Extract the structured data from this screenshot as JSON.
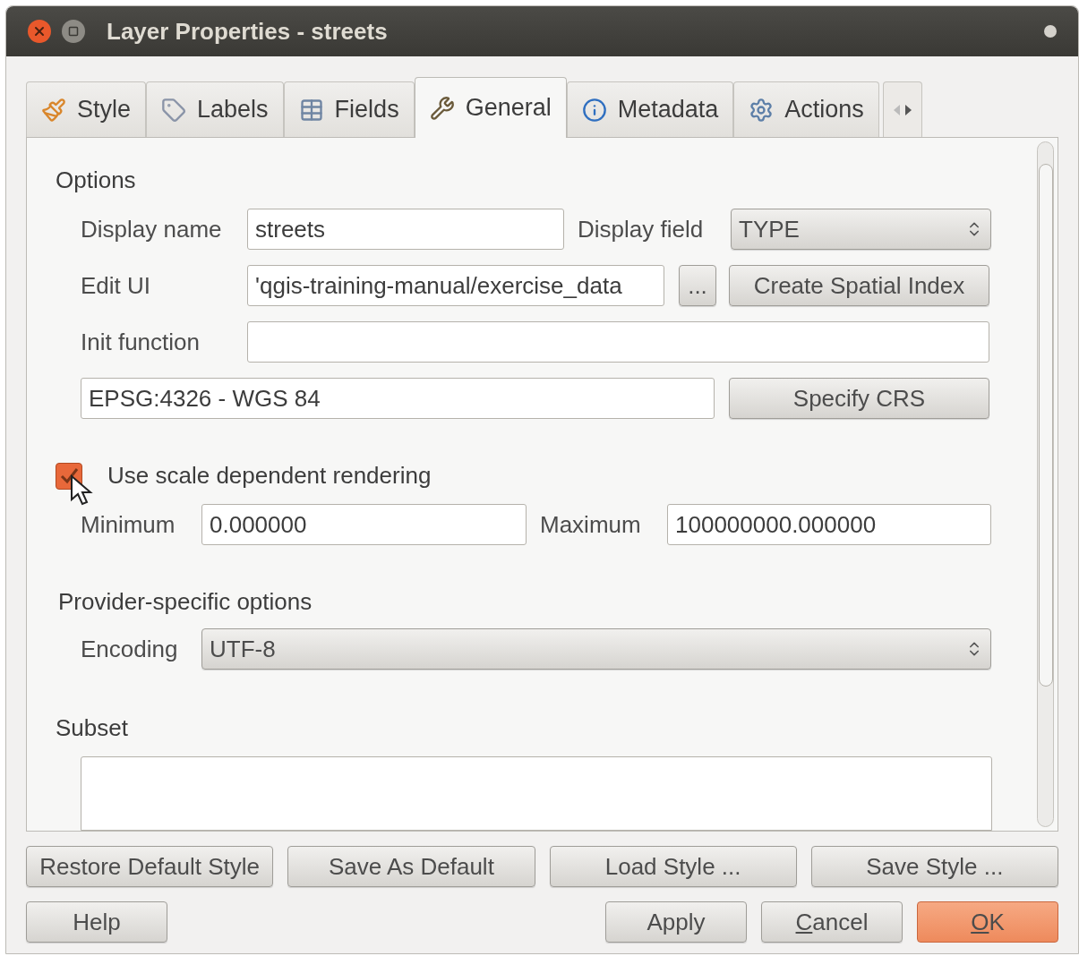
{
  "window": {
    "title": "Layer Properties - streets"
  },
  "tabs": [
    {
      "label": "Style",
      "selected": false
    },
    {
      "label": "Labels",
      "selected": false
    },
    {
      "label": "Fields",
      "selected": false
    },
    {
      "label": "General",
      "selected": true
    },
    {
      "label": "Metadata",
      "selected": false
    },
    {
      "label": "Actions",
      "selected": false
    }
  ],
  "options": {
    "title": "Options",
    "display_name": {
      "label": "Display name",
      "value": "streets"
    },
    "display_field": {
      "label": "Display field",
      "value": "TYPE"
    },
    "edit_ui": {
      "label": "Edit UI",
      "value": "'qgis-training-manual/exercise_data",
      "browse": "...",
      "button": "Create Spatial Index"
    },
    "init_function": {
      "label": "Init function"
    },
    "crs": {
      "value": "EPSG:4326 - WGS 84",
      "button": "Specify CRS"
    }
  },
  "scale": {
    "label": "Use scale dependent rendering",
    "checked": true,
    "minimum": {
      "label": "Minimum",
      "value": "0.000000"
    },
    "maximum": {
      "label": "Maximum",
      "value": "100000000.000000"
    }
  },
  "provider": {
    "title": "Provider-specific options",
    "encoding": {
      "label": "Encoding",
      "value": "UTF-8"
    }
  },
  "subset": {
    "title": "Subset"
  },
  "style_buttons": [
    "Restore Default Style",
    "Save As Default",
    "Load Style ...",
    "Save Style ..."
  ],
  "dialog_buttons": [
    {
      "label": "Help",
      "mnemonic": false,
      "default": false
    },
    {
      "label": "Apply",
      "mnemonic": false,
      "default": false
    },
    {
      "label": "Cancel",
      "mnemonic": true,
      "default": false
    },
    {
      "label": "OK",
      "mnemonic": true,
      "default": true
    }
  ]
}
